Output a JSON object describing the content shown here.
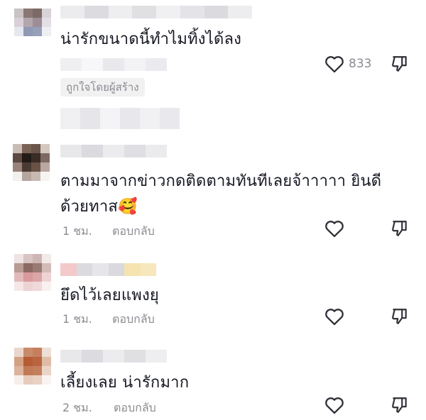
{
  "comments": [
    {
      "text": "น่ารักขนาดนี้ทำไมทิ้งได้ลง",
      "badge": "ถูกใจโดยผู้สร้าง",
      "likes": "833"
    },
    {
      "text_line1": "ตามมาจากข่าวกดติดตามทันทีเลยจ้าาาาา ยินดี",
      "text_line2": "ด้วยทาส",
      "emoji": "🥰",
      "time": "1 ชม.",
      "reply": "ตอบกลับ"
    },
    {
      "text": "ยึดไว้เลยแพงยุ",
      "time": "1 ชม.",
      "reply": "ตอบกลับ"
    },
    {
      "text": "เลี้ยงเลย น่ารักมาก",
      "time": "2 ชม.",
      "reply": "ตอบกลับ"
    }
  ],
  "icons": {
    "like": "heart-outline-icon",
    "dislike": "thumbs-down-icon"
  },
  "colors": {
    "text": "#161823",
    "muted": "#8a8b91",
    "badge_bg": "#f1f1f2"
  }
}
